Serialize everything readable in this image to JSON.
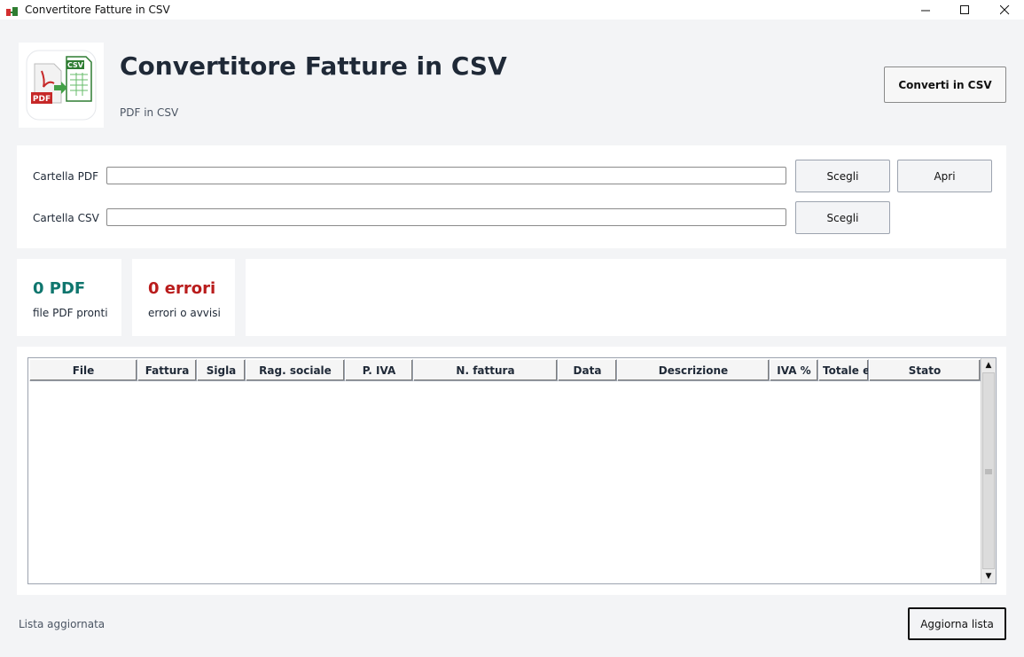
{
  "window": {
    "title": "Convertitore Fatture in CSV",
    "controls": {
      "minimize": "—",
      "maximize": "☐",
      "close": "✕"
    }
  },
  "header": {
    "title": "Convertitore Fatture in CSV",
    "subtitle": "PDF in CSV",
    "convert_button": "Converti in CSV",
    "logo": {
      "pdf_text": "PDF",
      "csv_text": "CSV"
    }
  },
  "folders": {
    "pdf_label": "Cartella PDF",
    "pdf_value": "",
    "csv_label": "Cartella CSV",
    "csv_value": "",
    "choose_pdf_button": "Scegli",
    "open_button": "Apri",
    "choose_csv_button": "Scegli"
  },
  "stats": {
    "pdf_count": "0 PDF",
    "pdf_caption": "file PDF pronti",
    "errors_count": "0 errori",
    "errors_caption": "errori o avvisi"
  },
  "table": {
    "columns": [
      "File",
      "Fattura",
      "Sigla",
      "Rag. sociale",
      "P. IVA",
      "N. fattura",
      "Data",
      "Descrizione",
      "IVA %",
      "Totale eu",
      "Stato"
    ],
    "rows": []
  },
  "footer": {
    "status": "Lista aggiornata",
    "refresh_button": "Aggiorna lista"
  },
  "colors": {
    "pdf_count": "#0f766e",
    "errors_count": "#b91c1c",
    "background": "#f3f4f6"
  }
}
